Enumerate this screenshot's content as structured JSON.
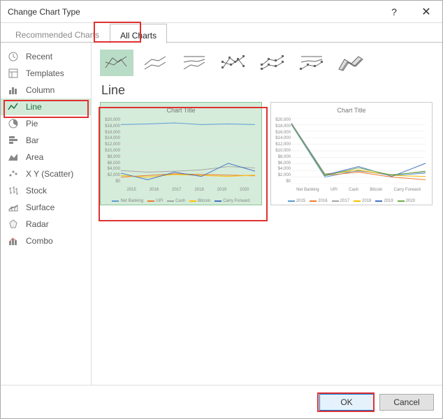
{
  "dialog": {
    "title": "Change Chart Type"
  },
  "tabs": [
    {
      "label": "Recommended Charts"
    },
    {
      "label": "All Charts"
    }
  ],
  "sidebar": {
    "items": [
      {
        "label": "Recent",
        "icon": "recent-icon"
      },
      {
        "label": "Templates",
        "icon": "templates-icon"
      },
      {
        "label": "Column",
        "icon": "column-icon"
      },
      {
        "label": "Line",
        "icon": "line-icon"
      },
      {
        "label": "Pie",
        "icon": "pie-icon"
      },
      {
        "label": "Bar",
        "icon": "bar-icon"
      },
      {
        "label": "Area",
        "icon": "area-icon"
      },
      {
        "label": "X Y (Scatter)",
        "icon": "scatter-icon"
      },
      {
        "label": "Stock",
        "icon": "stock-icon"
      },
      {
        "label": "Surface",
        "icon": "surface-icon"
      },
      {
        "label": "Radar",
        "icon": "radar-icon"
      },
      {
        "label": "Combo",
        "icon": "combo-icon"
      }
    ],
    "selected_index": 3
  },
  "subtypes": {
    "selected_index": 0,
    "items": [
      {
        "name": "line-subtype"
      },
      {
        "name": "stacked-line-subtype"
      },
      {
        "name": "100pct-line-subtype"
      },
      {
        "name": "line-markers-subtype"
      },
      {
        "name": "stacked-markers-subtype"
      },
      {
        "name": "100pct-markers-subtype"
      },
      {
        "name": "3d-line-subtype"
      }
    ]
  },
  "chart_type_heading": "Line",
  "previews": {
    "selected_index": 0,
    "items": [
      {
        "title": "Chart Title",
        "chart_data": {
          "type": "line",
          "ylim": [
            0,
            20000
          ],
          "y_ticks": [
            "$20,000",
            "$18,000",
            "$16,000",
            "$14,000",
            "$12,000",
            "$10,000",
            "$8,000",
            "$6,000",
            "$4,000",
            "$2,000",
            "$0"
          ],
          "categories": [
            "2015",
            "2016",
            "2017",
            "2018",
            "2019",
            "2020"
          ],
          "series": [
            {
              "name": "Net Banking",
              "color": "#5b9bd5",
              "values": [
                18000,
                18200,
                18500,
                18000,
                18200,
                18000
              ]
            },
            {
              "name": "UPI",
              "color": "#ed7d31",
              "values": [
                2000,
                2500,
                3000,
                2800,
                2600,
                2400
              ]
            },
            {
              "name": "Cash",
              "color": "#a5a5a5",
              "values": [
                4000,
                3500,
                3800,
                4200,
                5200,
                4800
              ]
            },
            {
              "name": "Bitcoin",
              "color": "#ffc000",
              "values": [
                2500,
                2000,
                2800,
                2500,
                2200,
                2600
              ]
            },
            {
              "name": "Carry Forward",
              "color": "#4472c4",
              "values": [
                3200,
                1200,
                3500,
                2200,
                6200,
                3800
              ]
            }
          ]
        }
      },
      {
        "title": "Chart Title",
        "chart_data": {
          "type": "line",
          "ylim": [
            0,
            20000
          ],
          "y_ticks": [
            "$20,000",
            "$18,000",
            "$16,000",
            "$14,000",
            "$12,000",
            "$10,000",
            "$8,000",
            "$6,000",
            "$4,000",
            "$2,000",
            "$0"
          ],
          "categories": [
            "Net Banking",
            "UPI",
            "Cash",
            "Bitcoin",
            "Carry Forward"
          ],
          "series": [
            {
              "name": "2015",
              "color": "#5b9bd5",
              "values": [
                18000,
                2000,
                4000,
                2500,
                3200
              ]
            },
            {
              "name": "2016",
              "color": "#ed7d31",
              "values": [
                18200,
                2500,
                3500,
                2000,
                1200
              ]
            },
            {
              "name": "2017",
              "color": "#a5a5a5",
              "values": [
                18500,
                3000,
                3800,
                2800,
                3500
              ]
            },
            {
              "name": "2018",
              "color": "#ffc000",
              "values": [
                18000,
                2800,
                4200,
                2500,
                2200
              ]
            },
            {
              "name": "2019",
              "color": "#4472c4",
              "values": [
                18200,
                2600,
                5200,
                2200,
                6200
              ]
            },
            {
              "name": "2020",
              "color": "#70ad47",
              "values": [
                18000,
                2400,
                4800,
                2600,
                3800
              ]
            }
          ]
        }
      }
    ]
  },
  "footer": {
    "ok": "OK",
    "cancel": "Cancel"
  }
}
